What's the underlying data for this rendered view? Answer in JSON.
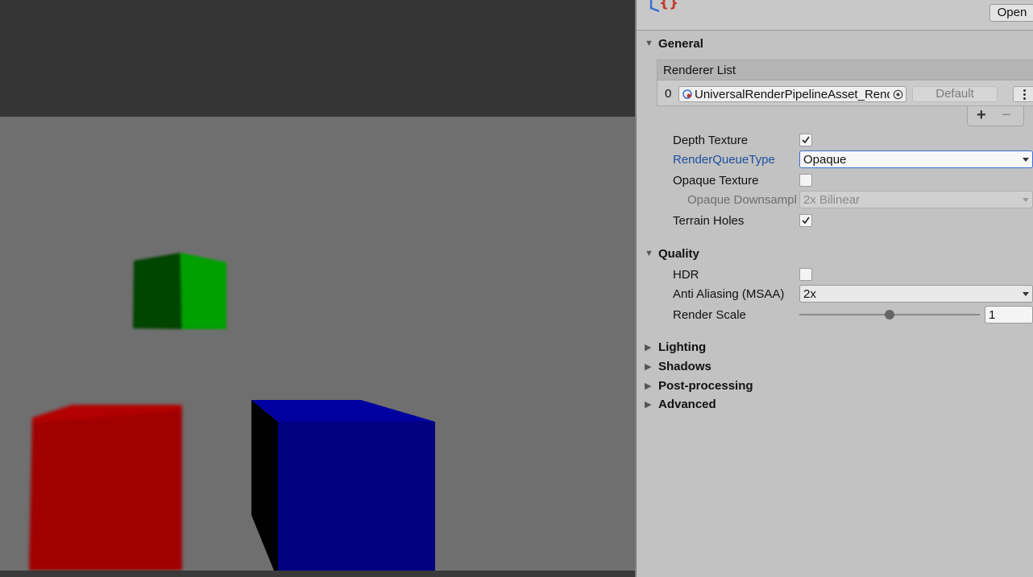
{
  "inspector": {
    "open_label": "Open",
    "general": {
      "title": "General",
      "renderer_list_title": "Renderer List",
      "renderer_index": "0",
      "renderer_asset": "UniversalRenderPipelineAsset_Renderer",
      "default_label": "Default",
      "plus": "+",
      "minus": "−",
      "depth_texture_label": "Depth Texture",
      "depth_texture_checked": true,
      "render_queue_label": "RenderQueueType",
      "render_queue_value": "Opaque",
      "opaque_texture_label": "Opaque Texture",
      "opaque_texture_checked": false,
      "opaque_downsampling_label": "Opaque Downsampling",
      "opaque_downsampling_value": "2x Bilinear",
      "terrain_holes_label": "Terrain Holes",
      "terrain_holes_checked": true
    },
    "quality": {
      "title": "Quality",
      "hdr_label": "HDR",
      "hdr_checked": false,
      "msaa_label": "Anti Aliasing (MSAA)",
      "msaa_value": "2x",
      "render_scale_label": "Render Scale",
      "render_scale_value": "1",
      "render_scale_fraction": 0.5
    },
    "collapsed_sections": [
      "Lighting",
      "Shadows",
      "Post-processing",
      "Advanced"
    ]
  },
  "scene": {
    "colors": {
      "background": "#353535",
      "floor": "#6f6f6f",
      "green_cube": "#00a000",
      "red_cube": "#a00000",
      "blue_cube": "#000080"
    }
  }
}
